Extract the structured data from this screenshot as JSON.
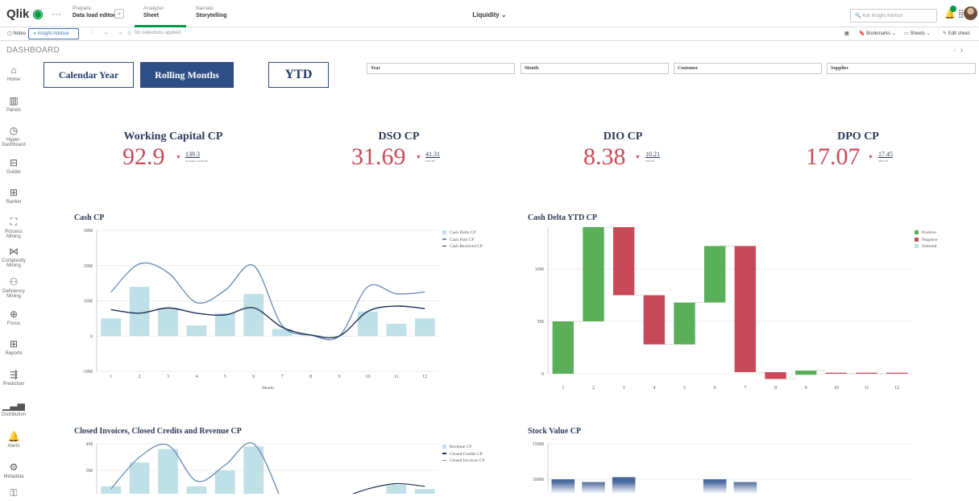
{
  "topbar": {
    "logo_text": "Qlik",
    "more": "···",
    "prepare": {
      "sub": "Prepare",
      "main": "Data load editor"
    },
    "analyzer": {
      "sub": "Analyzer",
      "main": "Sheet"
    },
    "narrate": {
      "sub": "Narrate",
      "main": "Storytelling"
    },
    "app_title": "Liquidity ⌄",
    "ask_placeholder": "Ask Insight Advisor"
  },
  "toolbar": {
    "notes": "Notes",
    "insight_advisor": "Insight Advisor",
    "no_selections": "No selections applied",
    "bookmarks": "Bookmarks",
    "sheets": "Sheets",
    "edit_sheet": "Edit sheet"
  },
  "dashboard_label": "DASHBOARD",
  "sidebar": [
    {
      "label": "Home",
      "icon": "home-icon",
      "glyph": "⌂"
    },
    {
      "label": "Panels",
      "icon": "panels-icon",
      "glyph": "▥"
    },
    {
      "label": "Hyper-\nDashboard",
      "icon": "gauge-icon",
      "glyph": "◷"
    },
    {
      "label": "Guider",
      "icon": "guider-icon",
      "glyph": "⊟"
    },
    {
      "label": "Ranker",
      "icon": "table-icon",
      "glyph": "⊞"
    },
    {
      "label": "Process\nMining",
      "icon": "process-mining-icon",
      "glyph": "⛶"
    },
    {
      "label": "Complexity\nMining",
      "icon": "complexity-icon",
      "glyph": "⋈"
    },
    {
      "label": "Deficiency\nMining",
      "icon": "deficiency-icon",
      "glyph": "⚇"
    },
    {
      "label": "Focus",
      "icon": "focus-icon",
      "glyph": "⊕"
    },
    {
      "label": "Reports",
      "icon": "reports-icon",
      "glyph": "⊞"
    },
    {
      "label": "Prediction",
      "icon": "prediction-icon",
      "glyph": "⇶"
    },
    {
      "label": "Distribution",
      "icon": "distribution-icon",
      "glyph": "▁▃▅"
    },
    {
      "label": "Alerts",
      "icon": "bell-icon",
      "glyph": "🔔"
    },
    {
      "label": "Metadata",
      "icon": "metadata-icon",
      "glyph": "⚙"
    },
    {
      "label": "",
      "icon": "more-icon",
      "glyph": "⚿"
    }
  ],
  "period_buttons": {
    "calendar": "Calendar Year",
    "rolling": "Rolling Months",
    "ytd": "YTD"
  },
  "filters": {
    "year": "Year",
    "month": "Month",
    "customer": "Customer",
    "supplier": "Supplier"
  },
  "kpis": [
    {
      "title": "Working Capital CP",
      "value": "92.9",
      "compare": "139.3",
      "compare_label": "Working Capital PP"
    },
    {
      "title": "DSO CP",
      "value": "31.69",
      "compare": "41.31",
      "compare_label": "DSO PP"
    },
    {
      "title": "DIO CP",
      "value": "8.38",
      "compare": "10.21",
      "compare_label": "DIO PP"
    },
    {
      "title": "DPO CP",
      "value": "17.07",
      "compare": "17.45",
      "compare_label": "DPO PP"
    }
  ],
  "colors": {
    "accent": "#009845",
    "navy": "#2d4f85",
    "kpi_red": "#c84a58",
    "bar_light": "#bfe0e6",
    "positive": "#5aaf58",
    "negative": "#c84a58"
  },
  "chart_data": [
    {
      "type": "bar",
      "title": "Cash CP",
      "xlabel": "Month",
      "categories": [
        "1",
        "2",
        "3",
        "4",
        "5",
        "6",
        "7",
        "8",
        "9",
        "10",
        "11",
        "12"
      ],
      "y_ticks": [
        "30M",
        "20M",
        "10M",
        "0",
        "-10M"
      ],
      "ylim": [
        -10,
        30
      ],
      "series": [
        {
          "name": "Cash Delta CP",
          "type": "bar",
          "values": [
            5,
            14,
            8,
            3,
            6.5,
            12,
            2,
            0.3,
            0,
            7,
            3.5,
            5
          ]
        },
        {
          "name": "Cash Paid CP",
          "type": "line",
          "values": [
            12.5,
            20.5,
            18,
            9.5,
            13,
            20,
            3,
            0.3,
            0,
            14,
            12,
            12.5
          ]
        },
        {
          "name": "Cash Received CP",
          "type": "line",
          "values": [
            7.5,
            6.5,
            8,
            6.5,
            6,
            8,
            2.5,
            0.3,
            0,
            7,
            8.5,
            7.8
          ]
        }
      ],
      "legend": "right"
    },
    {
      "type": "bar",
      "title": "Cash Delta YTD CP",
      "categories": [
        "1",
        "2",
        "3",
        "4",
        "5",
        "6",
        "7",
        "8",
        "9",
        "10",
        "11",
        "12"
      ],
      "y_ticks": [
        "10M",
        "5M",
        "0"
      ],
      "ylim": [
        0,
        14
      ],
      "waterfall": [
        {
          "start": 0,
          "end": 5,
          "kind": "Positive"
        },
        {
          "start": 5,
          "end": 14,
          "kind": "Positive"
        },
        {
          "start": 14,
          "end": 7.5,
          "kind": "Negative"
        },
        {
          "start": 7.5,
          "end": 2.8,
          "kind": "Negative"
        },
        {
          "start": 2.8,
          "end": 6.8,
          "kind": "Positive"
        },
        {
          "start": 6.8,
          "end": 12.2,
          "kind": "Positive"
        },
        {
          "start": 12.2,
          "end": 0.15,
          "kind": "Negative"
        },
        {
          "start": 0.15,
          "end": -0.5,
          "kind": "Negative"
        },
        {
          "start": -0.1,
          "end": 0.3,
          "kind": "Positive"
        },
        {
          "start": 0.1,
          "end": 0,
          "kind": "Negative"
        },
        {
          "start": 0.1,
          "end": 0,
          "kind": "Negative"
        },
        {
          "start": 0.1,
          "end": 0,
          "kind": "Negative"
        }
      ],
      "legend_items": [
        "Positive",
        "Negative",
        "Subtotal"
      ],
      "legend": "right"
    },
    {
      "type": "bar",
      "title": "Closed Invoices, Closed Credits and Revenue CP",
      "y_ticks": [
        "4M",
        "3M"
      ],
      "ylim": [
        2,
        4
      ],
      "series": [
        {
          "name": "Revenue CP",
          "type": "bar",
          "values": [
            2.4,
            3.3,
            3.8,
            2.4,
            3,
            3.9,
            null,
            null,
            null,
            null,
            2.45,
            2.3
          ]
        },
        {
          "name": "Closed Credits CP",
          "type": "line",
          "values": []
        },
        {
          "name": "Closed Invoices CP",
          "type": "line",
          "values": [
            2.3,
            3.5,
            3.95,
            2.6,
            3.2,
            4.0,
            null,
            null,
            null,
            2.2,
            2.5,
            2.4
          ]
        }
      ],
      "legend": "right"
    },
    {
      "type": "bar",
      "title": "Stock Value CP",
      "y_ticks": [
        "150M",
        "100M"
      ],
      "ylim": [
        80,
        150
      ],
      "values": [
        100,
        96,
        103,
        null,
        null,
        100,
        96
      ],
      "legend": "none"
    }
  ]
}
